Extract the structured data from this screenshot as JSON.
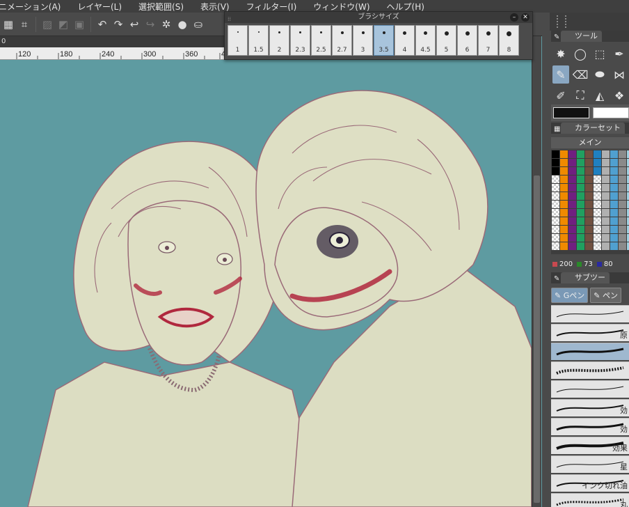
{
  "menu": [
    "ニメーション(A)",
    "レイヤー(L)",
    "選択範囲(S)",
    "表示(V)",
    "フィルター(I)",
    "ウィンドウ(W)",
    "ヘルプ(H)"
  ],
  "canvas_tab": "0",
  "ruler_labels": [
    "120",
    "180",
    "240",
    "300",
    "360",
    "4"
  ],
  "brush_size": {
    "title": "ブラシサイズ",
    "sizes": [
      "1",
      "1.5",
      "2",
      "2.3",
      "2.5",
      "2.7",
      "3",
      "3.5",
      "4",
      "4.5",
      "5",
      "6",
      "7",
      "8"
    ],
    "selected": "3.5"
  },
  "tool_panel": {
    "title": "ツール"
  },
  "color_set": {
    "title": "カラーセット",
    "set_name": "メイン",
    "r": "200",
    "g": "73",
    "b": "80",
    "r_color": "#c84950",
    "g_color": "#2a8a2a",
    "b_color": "#2a2aa0"
  },
  "sub_tool": {
    "title": "サブツー",
    "tabs": [
      "Gペン",
      "ペン"
    ],
    "brushes": [
      "",
      "原",
      "",
      "",
      "",
      "効",
      "効",
      "効果",
      "星",
      "インク切れ油",
      "丸",
      ""
    ]
  },
  "colors": {
    "canvas_bg": "#5e9ba1",
    "skin": "#dedfc4",
    "line": "#9a6a78",
    "lips": "#b0283e"
  }
}
